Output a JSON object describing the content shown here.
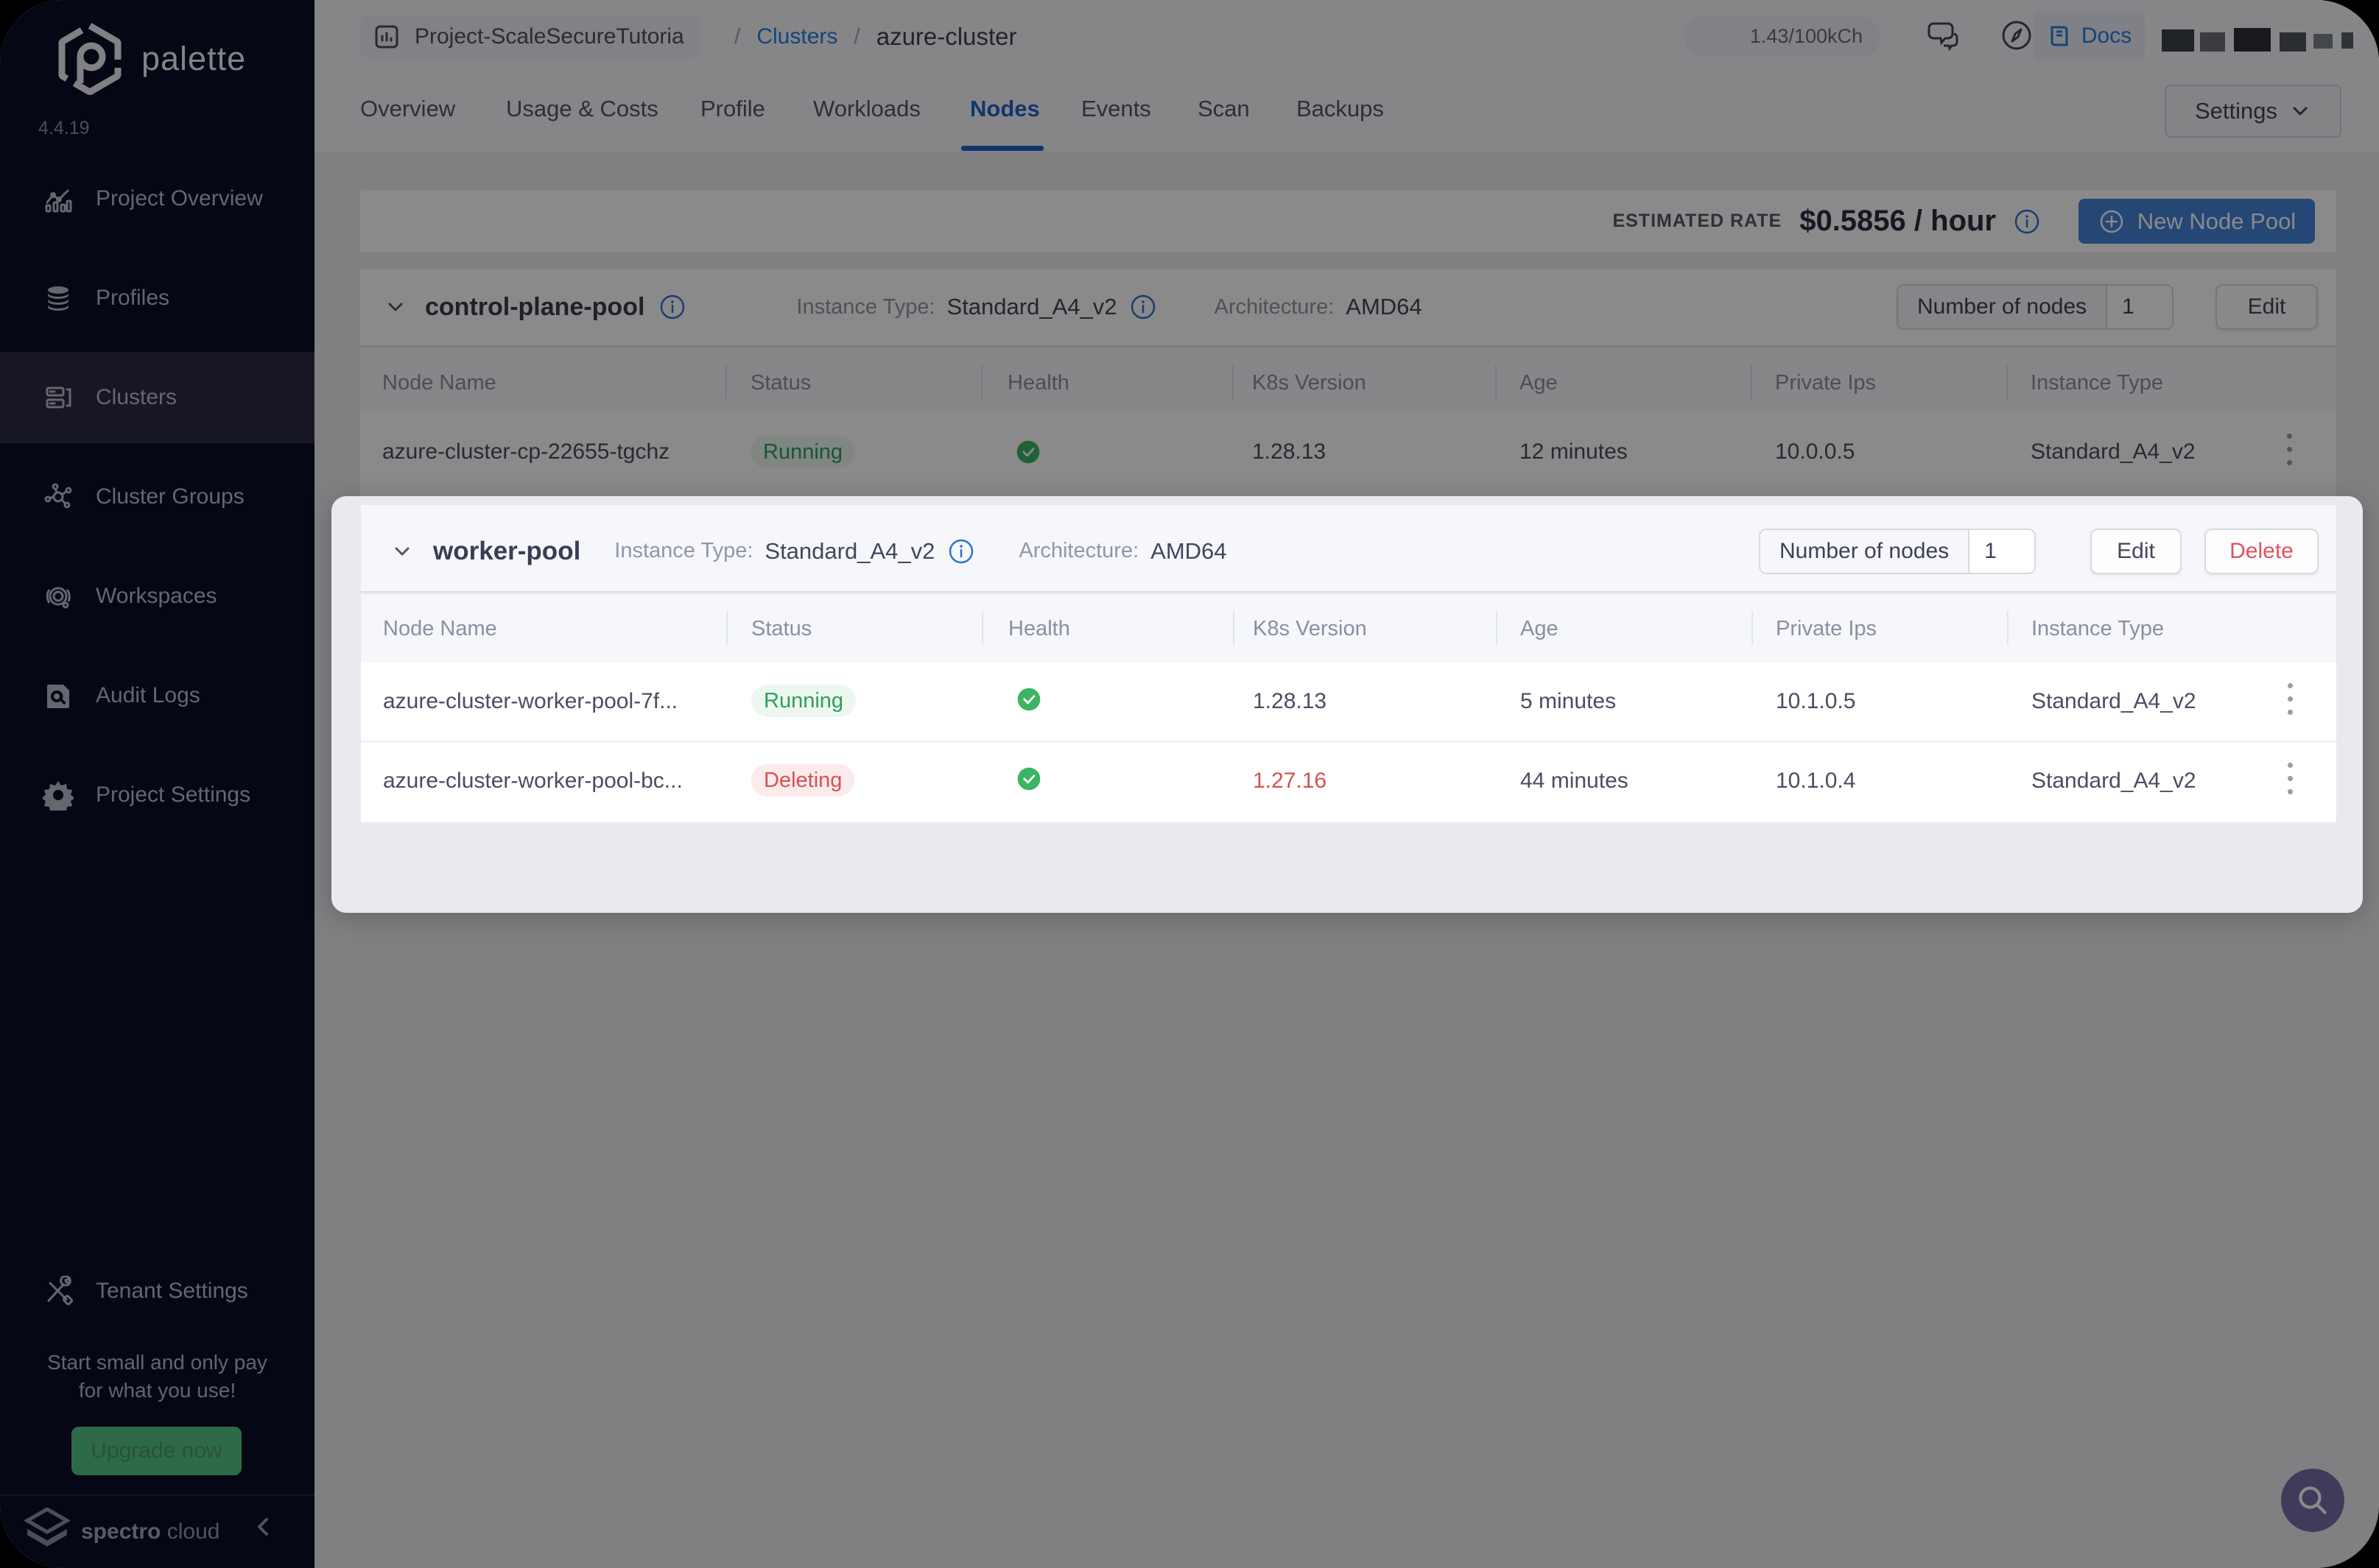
{
  "sidebar": {
    "logo_text": "palette",
    "version": "4.4.19",
    "items": [
      {
        "label": "Project Overview"
      },
      {
        "label": "Profiles"
      },
      {
        "label": "Clusters"
      },
      {
        "label": "Cluster Groups"
      },
      {
        "label": "Workspaces"
      },
      {
        "label": "Audit Logs"
      },
      {
        "label": "Project Settings"
      },
      {
        "label": "Tenant Settings"
      }
    ],
    "promo_line1": "Start small and only pay",
    "promo_line2": "for what you use!",
    "upgrade_label": "Upgrade now",
    "brand_bold": "spectro",
    "brand_light": "cloud"
  },
  "header": {
    "breadcrumb_project": "Project-ScaleSecureTutoria",
    "sep1": "/",
    "breadcrumb_section": "Clusters",
    "sep2": "/",
    "breadcrumb_current": "azure-cluster",
    "credits": "1.43/100kCh",
    "docs_label": "Docs"
  },
  "tabs": {
    "items": [
      "Overview",
      "Usage & Costs",
      "Profile",
      "Workloads",
      "Nodes",
      "Events",
      "Scan",
      "Backups"
    ],
    "active": "Nodes",
    "settings_label": "Settings"
  },
  "ratebar": {
    "label": "ESTIMATED RATE",
    "value": "$0.5856 / hour",
    "new_pool_label": "New Node Pool"
  },
  "columns": [
    "Node Name",
    "Status",
    "Health",
    "K8s Version",
    "Age",
    "Private Ips",
    "Instance Type"
  ],
  "pools": [
    {
      "name": "control-plane-pool",
      "instance_type_label": "Instance Type:",
      "instance_type": "Standard_A4_v2",
      "arch_label": "Architecture:",
      "arch": "AMD64",
      "nodes_label": "Number of nodes",
      "nodes_value": "1",
      "edit_label": "Edit",
      "rows": [
        {
          "name": "azure-cluster-cp-22655-tgchz",
          "status": "Running",
          "k8s": "1.28.13",
          "age": "12 minutes",
          "ip": "10.0.0.5",
          "type": "Standard_A4_v2"
        }
      ]
    },
    {
      "name": "worker-pool",
      "instance_type_label": "Instance Type:",
      "instance_type": "Standard_A4_v2",
      "arch_label": "Architecture:",
      "arch": "AMD64",
      "nodes_label": "Number of nodes",
      "nodes_value": "1",
      "edit_label": "Edit",
      "delete_label": "Delete",
      "rows": [
        {
          "name": "azure-cluster-worker-pool-7f...",
          "status": "Running",
          "k8s": "1.28.13",
          "age": "5 minutes",
          "ip": "10.1.0.5",
          "type": "Standard_A4_v2"
        },
        {
          "name": "azure-cluster-worker-pool-bc...",
          "status": "Deleting",
          "k8s": "1.27.16",
          "age": "44 minutes",
          "ip": "10.1.0.4",
          "type": "Standard_A4_v2"
        }
      ]
    }
  ]
}
